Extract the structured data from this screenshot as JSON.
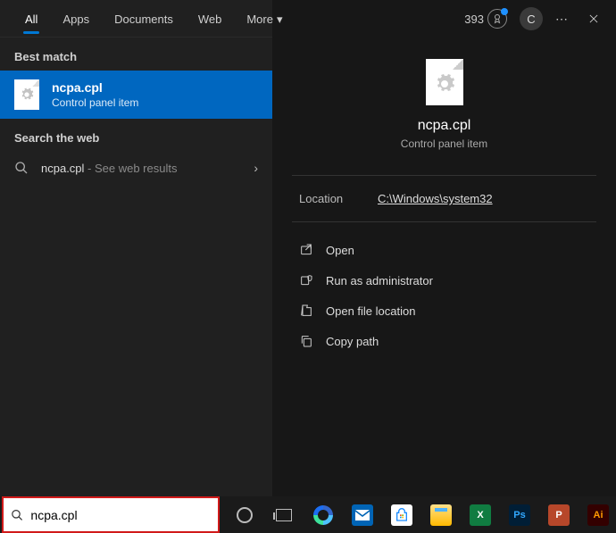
{
  "tabs": {
    "all": "All",
    "apps": "Apps",
    "documents": "Documents",
    "web": "Web",
    "more": "More"
  },
  "topbar": {
    "rewards": "393",
    "avatar": "C"
  },
  "left": {
    "best_match_header": "Best match",
    "best_match": {
      "title": "ncpa.cpl",
      "sub": "Control panel item"
    },
    "search_web_header": "Search the web",
    "web_result": {
      "term": "ncpa.cpl",
      "suffix": " - See web results"
    }
  },
  "detail": {
    "title": "ncpa.cpl",
    "sub": "Control panel item",
    "location_label": "Location",
    "location_path": "C:\\Windows\\system32",
    "actions": {
      "open": "Open",
      "admin": "Run as administrator",
      "loc": "Open file location",
      "copy": "Copy path"
    }
  },
  "taskbar": {
    "search_value": "ncpa.cpl"
  },
  "apps": {
    "mail": {
      "bg": "#0064b5",
      "letter": ""
    },
    "store": {
      "bg": "#ffffff"
    },
    "explorer": {
      "bg": "#ffcc33"
    },
    "excel": {
      "bg": "#107c41",
      "letter": "X"
    },
    "ps": {
      "bg": "#001e36",
      "letter": "Ps",
      "fg": "#31a8ff"
    },
    "pp": {
      "bg": "#b7472a",
      "letter": "P"
    },
    "ai": {
      "bg": "#330000",
      "letter": "Ai",
      "fg": "#ff9a00"
    }
  }
}
